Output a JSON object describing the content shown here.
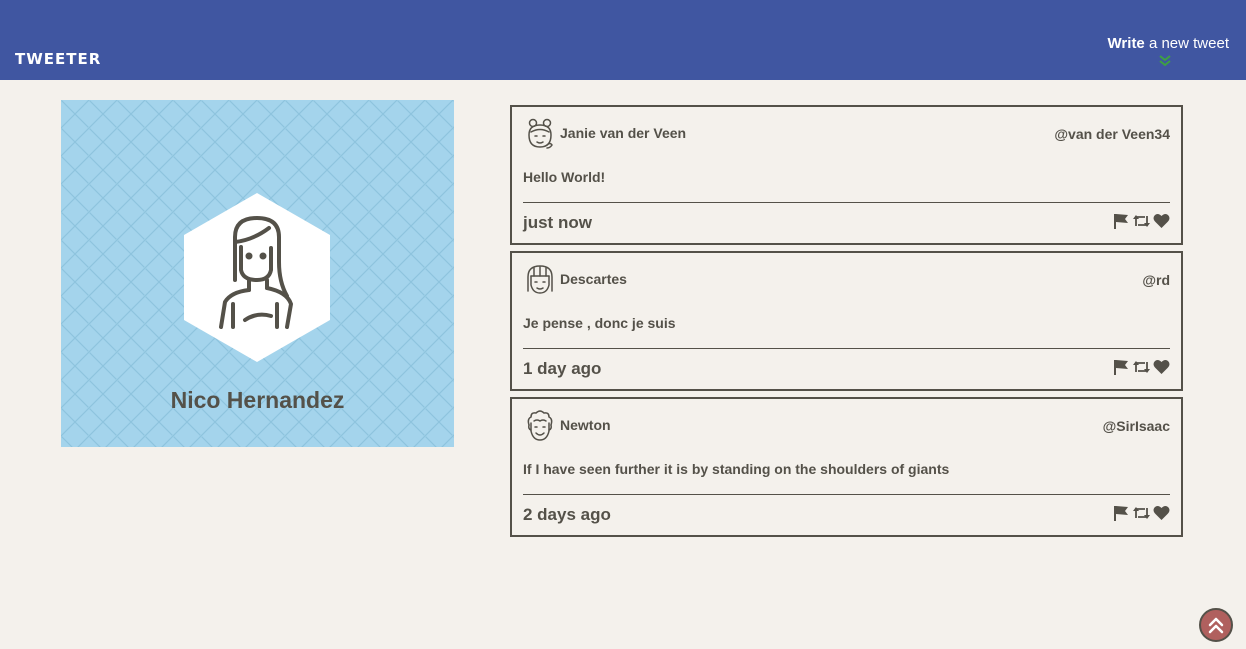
{
  "nav": {
    "brand": "TWEETER",
    "write_bold": "Write",
    "write_rest": " a new tweet",
    "write_icon": "double-chevron-down-icon",
    "write_icon_color": "#3ea043"
  },
  "colors": {
    "nav_bg": "#4056a1",
    "page_bg": "#f4f1ec",
    "text": "#545149",
    "profile_bg": "#a4d4ec",
    "scroll_button": "#b0605e"
  },
  "profile": {
    "name": "Nico Hernandez",
    "avatar_icon": "woman-avatar-icon"
  },
  "tweets": [
    {
      "name": "Janie van der Veen",
      "handle": "@van der Veen34",
      "text": "Hello World!",
      "time": "just now",
      "avatar_icon": "girl-buns-avatar-icon"
    },
    {
      "name": "Descartes",
      "handle": "@rd",
      "text": "Je pense , donc je suis",
      "time": "1 day ago",
      "avatar_icon": "bangs-avatar-icon"
    },
    {
      "name": "Newton",
      "handle": "@SirIsaac",
      "text": "If I have seen further it is by standing on the shoulders of giants",
      "time": "2 days ago",
      "avatar_icon": "curly-hair-avatar-icon"
    }
  ],
  "tweet_actions": [
    "flag-icon",
    "retweet-icon",
    "heart-icon"
  ],
  "scroll_top_icon": "double-chevron-up-icon"
}
